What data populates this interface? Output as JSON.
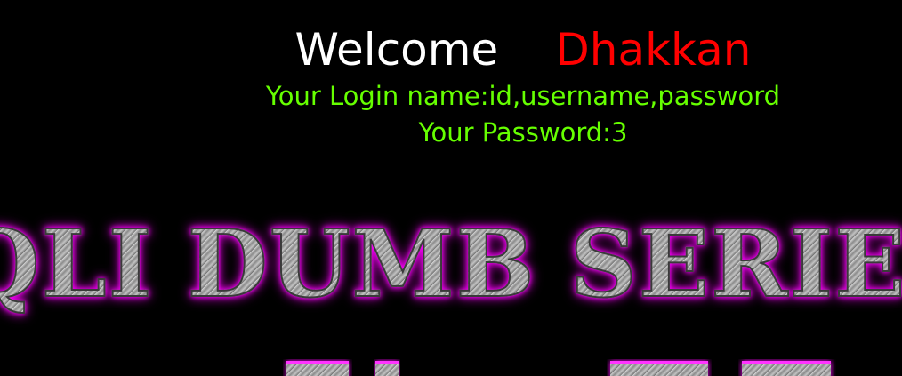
{
  "welcome": {
    "greeting": "Welcome",
    "name": "Dhakkan"
  },
  "login": {
    "login_name_line": "Your Login name:id,username,password",
    "password_line": "Your Password:3"
  },
  "banner": {
    "title": "QLI DUMB SERIES"
  },
  "colors": {
    "background": "#000000",
    "greeting": "#ffffff",
    "name": "#ff0000",
    "info_text": "#66ff00",
    "banner_glow": "#ff00ff"
  }
}
